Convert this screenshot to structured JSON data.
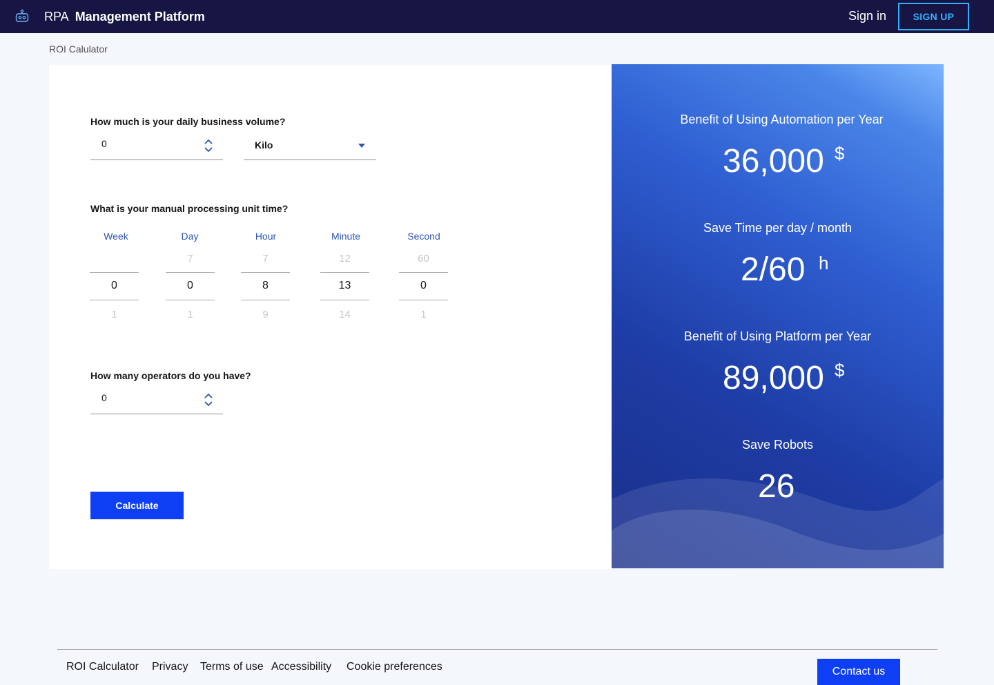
{
  "header": {
    "brand_prefix": "RPA",
    "brand_name": "Management Platform",
    "signin_label": "Sign in",
    "signup_label": "SIGN UP"
  },
  "breadcrumb": "ROI Calulator",
  "form": {
    "q1": "How much is your daily business volume?",
    "volume_value": "0",
    "volume_unit": "Kilo",
    "q2": "What is your manual processing unit time?",
    "time_columns": [
      {
        "label": "Week",
        "prev": "",
        "value": "0",
        "next": "1"
      },
      {
        "label": "Day",
        "prev": "7",
        "value": "0",
        "next": "1"
      },
      {
        "label": "Hour",
        "prev": "7",
        "value": "8",
        "next": "9"
      },
      {
        "label": "Minute",
        "prev": "12",
        "value": "13",
        "next": "14"
      },
      {
        "label": "Second",
        "prev": "60",
        "value": "0",
        "next": "1"
      }
    ],
    "q3": "How many operators do you have?",
    "operators_value": "0",
    "calculate_label": "Calculate"
  },
  "results": [
    {
      "label": "Benefit of Using Automation per Year",
      "value": "36,000",
      "unit": "$"
    },
    {
      "label": "Save Time per day / month",
      "value": "2/60",
      "unit": "h"
    },
    {
      "label": "Benefit of Using Platform per Year",
      "value": "89,000",
      "unit": "$"
    },
    {
      "label": "Save Robots",
      "value": "26",
      "unit": ""
    }
  ],
  "footer": {
    "links": [
      "ROI Calculator",
      "Privacy",
      "Terms of use",
      "Accessibility",
      "Cookie preferences"
    ],
    "contact_label": "Contact us"
  },
  "colors": {
    "header_bg": "#161544",
    "accent": "#0f3ff5",
    "signup_border": "#33b1ff",
    "column_label": "#2d55b8"
  },
  "icons": [
    "robot-icon",
    "stepper-icon",
    "chevron-down-icon"
  ]
}
